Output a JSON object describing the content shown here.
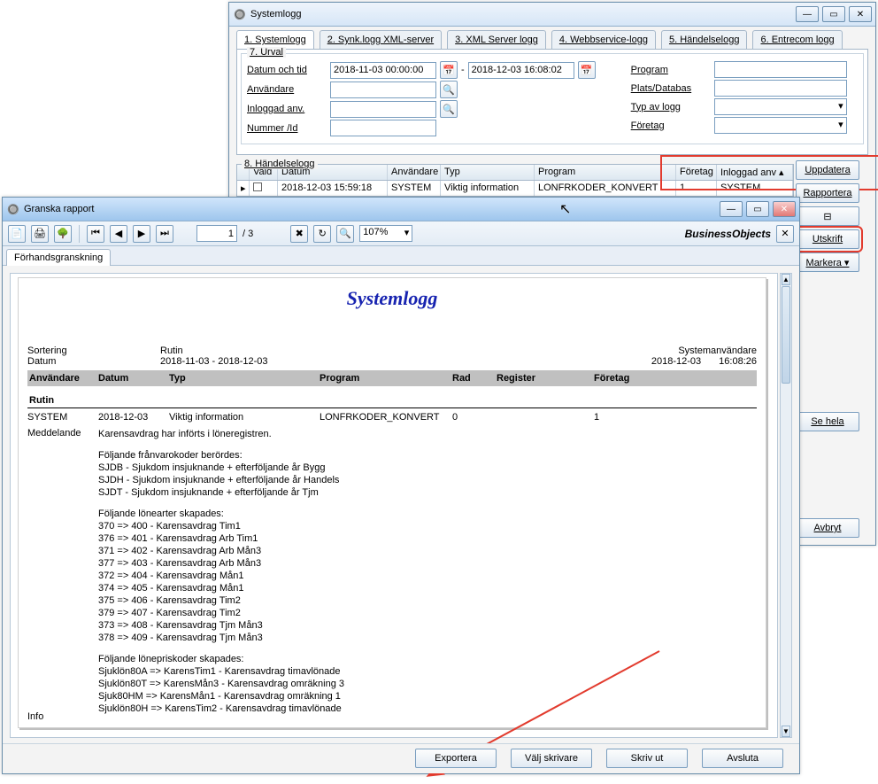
{
  "parent": {
    "title": "Systemlogg",
    "tabs": [
      "1. Systemlogg",
      "2. Synk.logg XML-server",
      "3. XML Server logg",
      "4. Webbservice-logg",
      "5. Händelselogg",
      "6. Entrecom logg"
    ],
    "urval_legend": "7. Urval",
    "labels": {
      "datum": "Datum och tid",
      "anvandare": "Användare",
      "inloggad": "Inloggad anv.",
      "nummer": "Nummer /Id",
      "program": "Program",
      "plats": "Plats/Databas",
      "typ": "Typ av logg",
      "foretag": "Företag"
    },
    "date_from": "2018-11-03 00:00:00",
    "date_to": "2018-12-03 16:08:02",
    "hlegend": "8. Händelselogg",
    "cols": [
      "Vald",
      "Datum",
      "Användare",
      "Typ",
      "Program",
      "Företag",
      "Inloggad anv"
    ],
    "row": {
      "datum": "2018-12-03 15:59:18",
      "anvandare": "SYSTEM",
      "typ": "Viktig information",
      "program": "LONFRKODER_KONVERT",
      "foretag": "1",
      "inl": "SYSTEM"
    },
    "buttons": {
      "uppdatera": "Uppdatera",
      "rapportera": "Rapportera",
      "icon": "⊟",
      "utskrift": "Utskrift",
      "markera": "Markera  ▾",
      "sehela": "Se hela",
      "avbryt": "Avbryt"
    }
  },
  "preview": {
    "title": "Granska rapport",
    "page_current": "1",
    "page_total": "/ 3",
    "zoom": "107%",
    "brand": "BusinessObjects",
    "subtab": "Förhandsgranskning",
    "bottom": {
      "export": "Exportera",
      "printer": "Välj skrivare",
      "print": "Skriv ut",
      "close": "Avsluta"
    },
    "report": {
      "title": "Systemlogg",
      "meta": {
        "sortering_l": "Sortering",
        "sortering_v": "Rutin",
        "right_top": "Systemanvändare",
        "datum_l": "Datum",
        "datum_v": "2018-11-03 - 2018-12-03",
        "right_date": "2018-12-03",
        "right_time": "16:08:26"
      },
      "headers": [
        "Användare",
        "Datum",
        "Typ",
        "Program",
        "Rad",
        "Register",
        "Företag"
      ],
      "rutin": "Rutin",
      "row": {
        "anv": "SYSTEM",
        "datum": "2018-12-03",
        "typ": "Viktig information",
        "program": "LONFRKODER_KONVERT",
        "rad": "0",
        "foretag": "1"
      },
      "medd_l": "Meddelande",
      "medd_text": "Karensavdrag har införts i löneregistren.",
      "block1_title": "Följande frånvarokoder berördes:",
      "block1": [
        "SJDB    - Sjukdom insjuknande + efterföljande år Bygg",
        "SJDH    - Sjukdom insjuknande + efterföljande år Handels",
        "SJDT    - Sjukdom insjuknande + efterföljande år Tjm"
      ],
      "block2_title": "Följande lönearter skapades:",
      "block2": [
        "370 => 400 - Karensavdrag Tim1",
        "376 => 401 - Karensavdrag Arb Tim1",
        "371 => 402 - Karensavdrag Arb Mån3",
        "377 => 403 - Karensavdrag Arb Mån3",
        "372 => 404 - Karensavdrag Mån1",
        "374 => 405 - Karensavdrag Mån1",
        "375 => 406 - Karensavdrag Tim2",
        "379 => 407 - Karensavdrag Tim2",
        "373 => 408 - Karensavdrag Tjm Mån3",
        "378 => 409 - Karensavdrag Tjm Mån3"
      ],
      "block3_title": "Följande lönepriskoder skapades:",
      "block3": [
        "Sjuklön80A => KarensTim1 - Karensavdrag timavlönade",
        "Sjuklön80T => KarensMån3 - Karensavdrag omräkning 3",
        "Sjuk80HM   => KarensMån1 - Karensavdrag omräkning 1",
        "Sjuklön80H => KarensTim2 - Karensavdrag timavlönade"
      ],
      "info": "Info"
    }
  }
}
